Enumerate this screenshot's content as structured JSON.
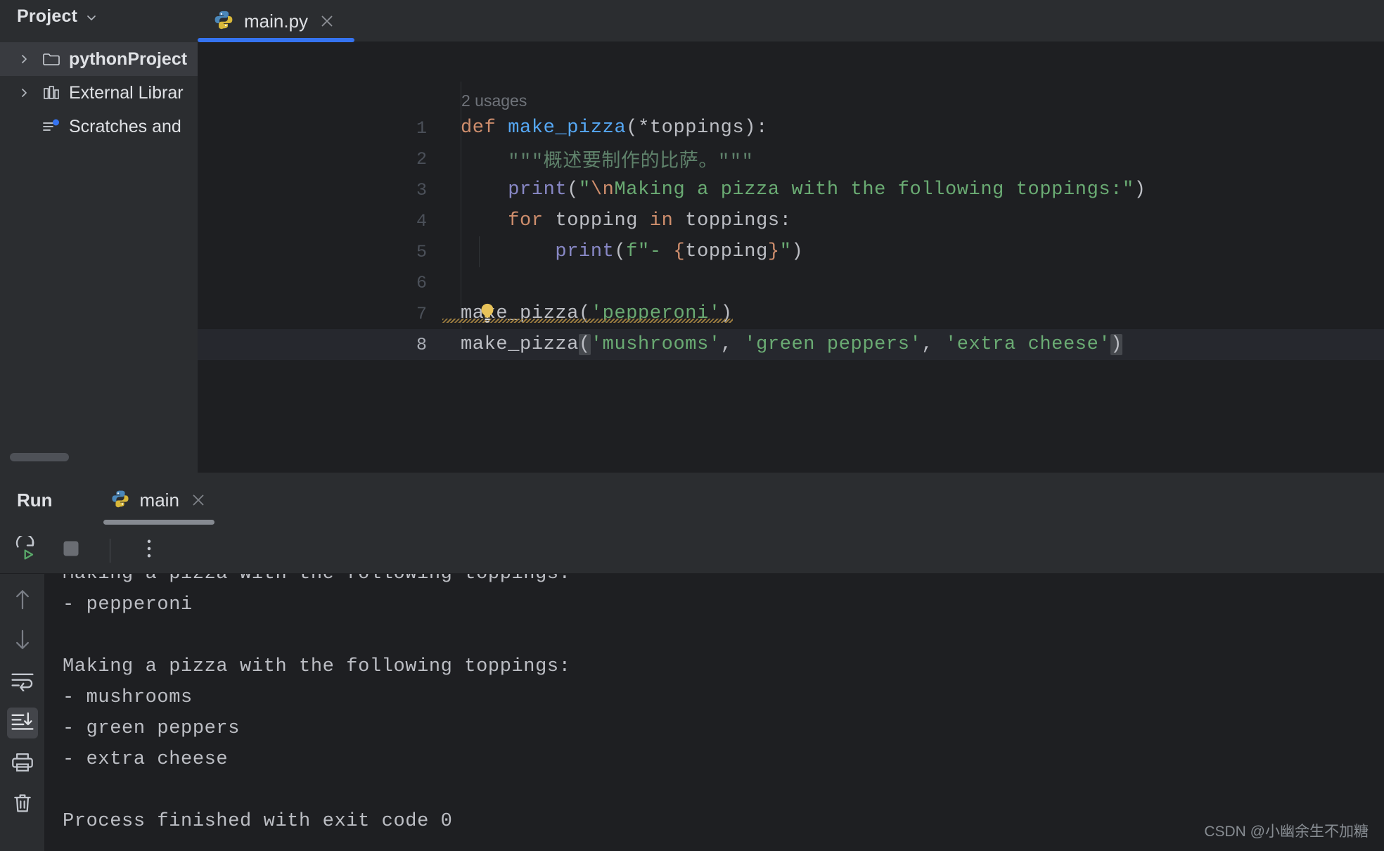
{
  "sidebar": {
    "title": "Project",
    "chevron_icon": "chevron-down-icon",
    "items": [
      {
        "label": "pythonProject",
        "icon": "folder-icon",
        "arrow": "chevron-right-icon",
        "selected": true
      },
      {
        "label": "External Librar",
        "icon": "library-icon",
        "arrow": "chevron-right-icon",
        "selected": false
      },
      {
        "label": "Scratches and",
        "icon": "scratches-icon",
        "arrow": "",
        "selected": false
      }
    ]
  },
  "editor": {
    "tab": {
      "label": "main.py",
      "icon": "python-icon",
      "close_icon": "close-icon",
      "active": true
    },
    "inlay_hint": "2 usages",
    "lines": [
      {
        "n": "1",
        "text": "def make_pizza(*toppings):"
      },
      {
        "n": "2",
        "text": "    \"\"\"概述要制作的比萨。\"\"\""
      },
      {
        "n": "3",
        "text": "    print(\"\\nMaking a pizza with the following toppings:\")"
      },
      {
        "n": "4",
        "text": "    for topping in toppings:"
      },
      {
        "n": "5",
        "text": "        print(f\"- {topping}\")"
      },
      {
        "n": "6",
        "text": ""
      },
      {
        "n": "7",
        "text": "make_pizza('pepperoni')"
      },
      {
        "n": "8",
        "text": "make_pizza('mushrooms', 'green peppers', 'extra cheese')"
      }
    ],
    "current_line": "8",
    "warning_line": "7",
    "bulb_icon": "lightbulb-icon"
  },
  "run_panel": {
    "title": "Run",
    "tab": {
      "label": "main",
      "icon": "python-icon",
      "close_icon": "close-icon"
    },
    "toolbar": [
      {
        "name": "rerun-button",
        "icon": "rerun-icon"
      },
      {
        "name": "stop-button",
        "icon": "stop-icon"
      },
      {
        "name": "more-options-button",
        "icon": "more-vertical-icon"
      }
    ],
    "console_gutter": [
      {
        "name": "previous-occurrence-button",
        "icon": "arrow-up-icon",
        "active": false
      },
      {
        "name": "next-occurrence-button",
        "icon": "arrow-down-icon",
        "active": false
      },
      {
        "name": "soft-wrap-button",
        "icon": "soft-wrap-icon",
        "active": false
      },
      {
        "name": "scroll-to-end-button",
        "icon": "scroll-to-end-icon",
        "active": true
      },
      {
        "name": "print-button",
        "icon": "printer-icon",
        "active": false
      },
      {
        "name": "clear-all-button",
        "icon": "trash-icon",
        "active": false
      }
    ],
    "output": [
      "Making a pizza with the following toppings:",
      "- pepperoni",
      "",
      "Making a pizza with the following toppings:",
      "- mushrooms",
      "- green peppers",
      "- extra cheese",
      "",
      "Process finished with exit code 0"
    ]
  },
  "watermark": "CSDN @小幽余生不加糖",
  "colors": {
    "accent": "#3573f0",
    "editor_bg": "#1e1f22",
    "panel_bg": "#2b2d30",
    "current_line": "#26282e",
    "string": "#6aab73",
    "keyword": "#cf8e6d",
    "function": "#56a8f5",
    "text": "#bcbec4"
  }
}
